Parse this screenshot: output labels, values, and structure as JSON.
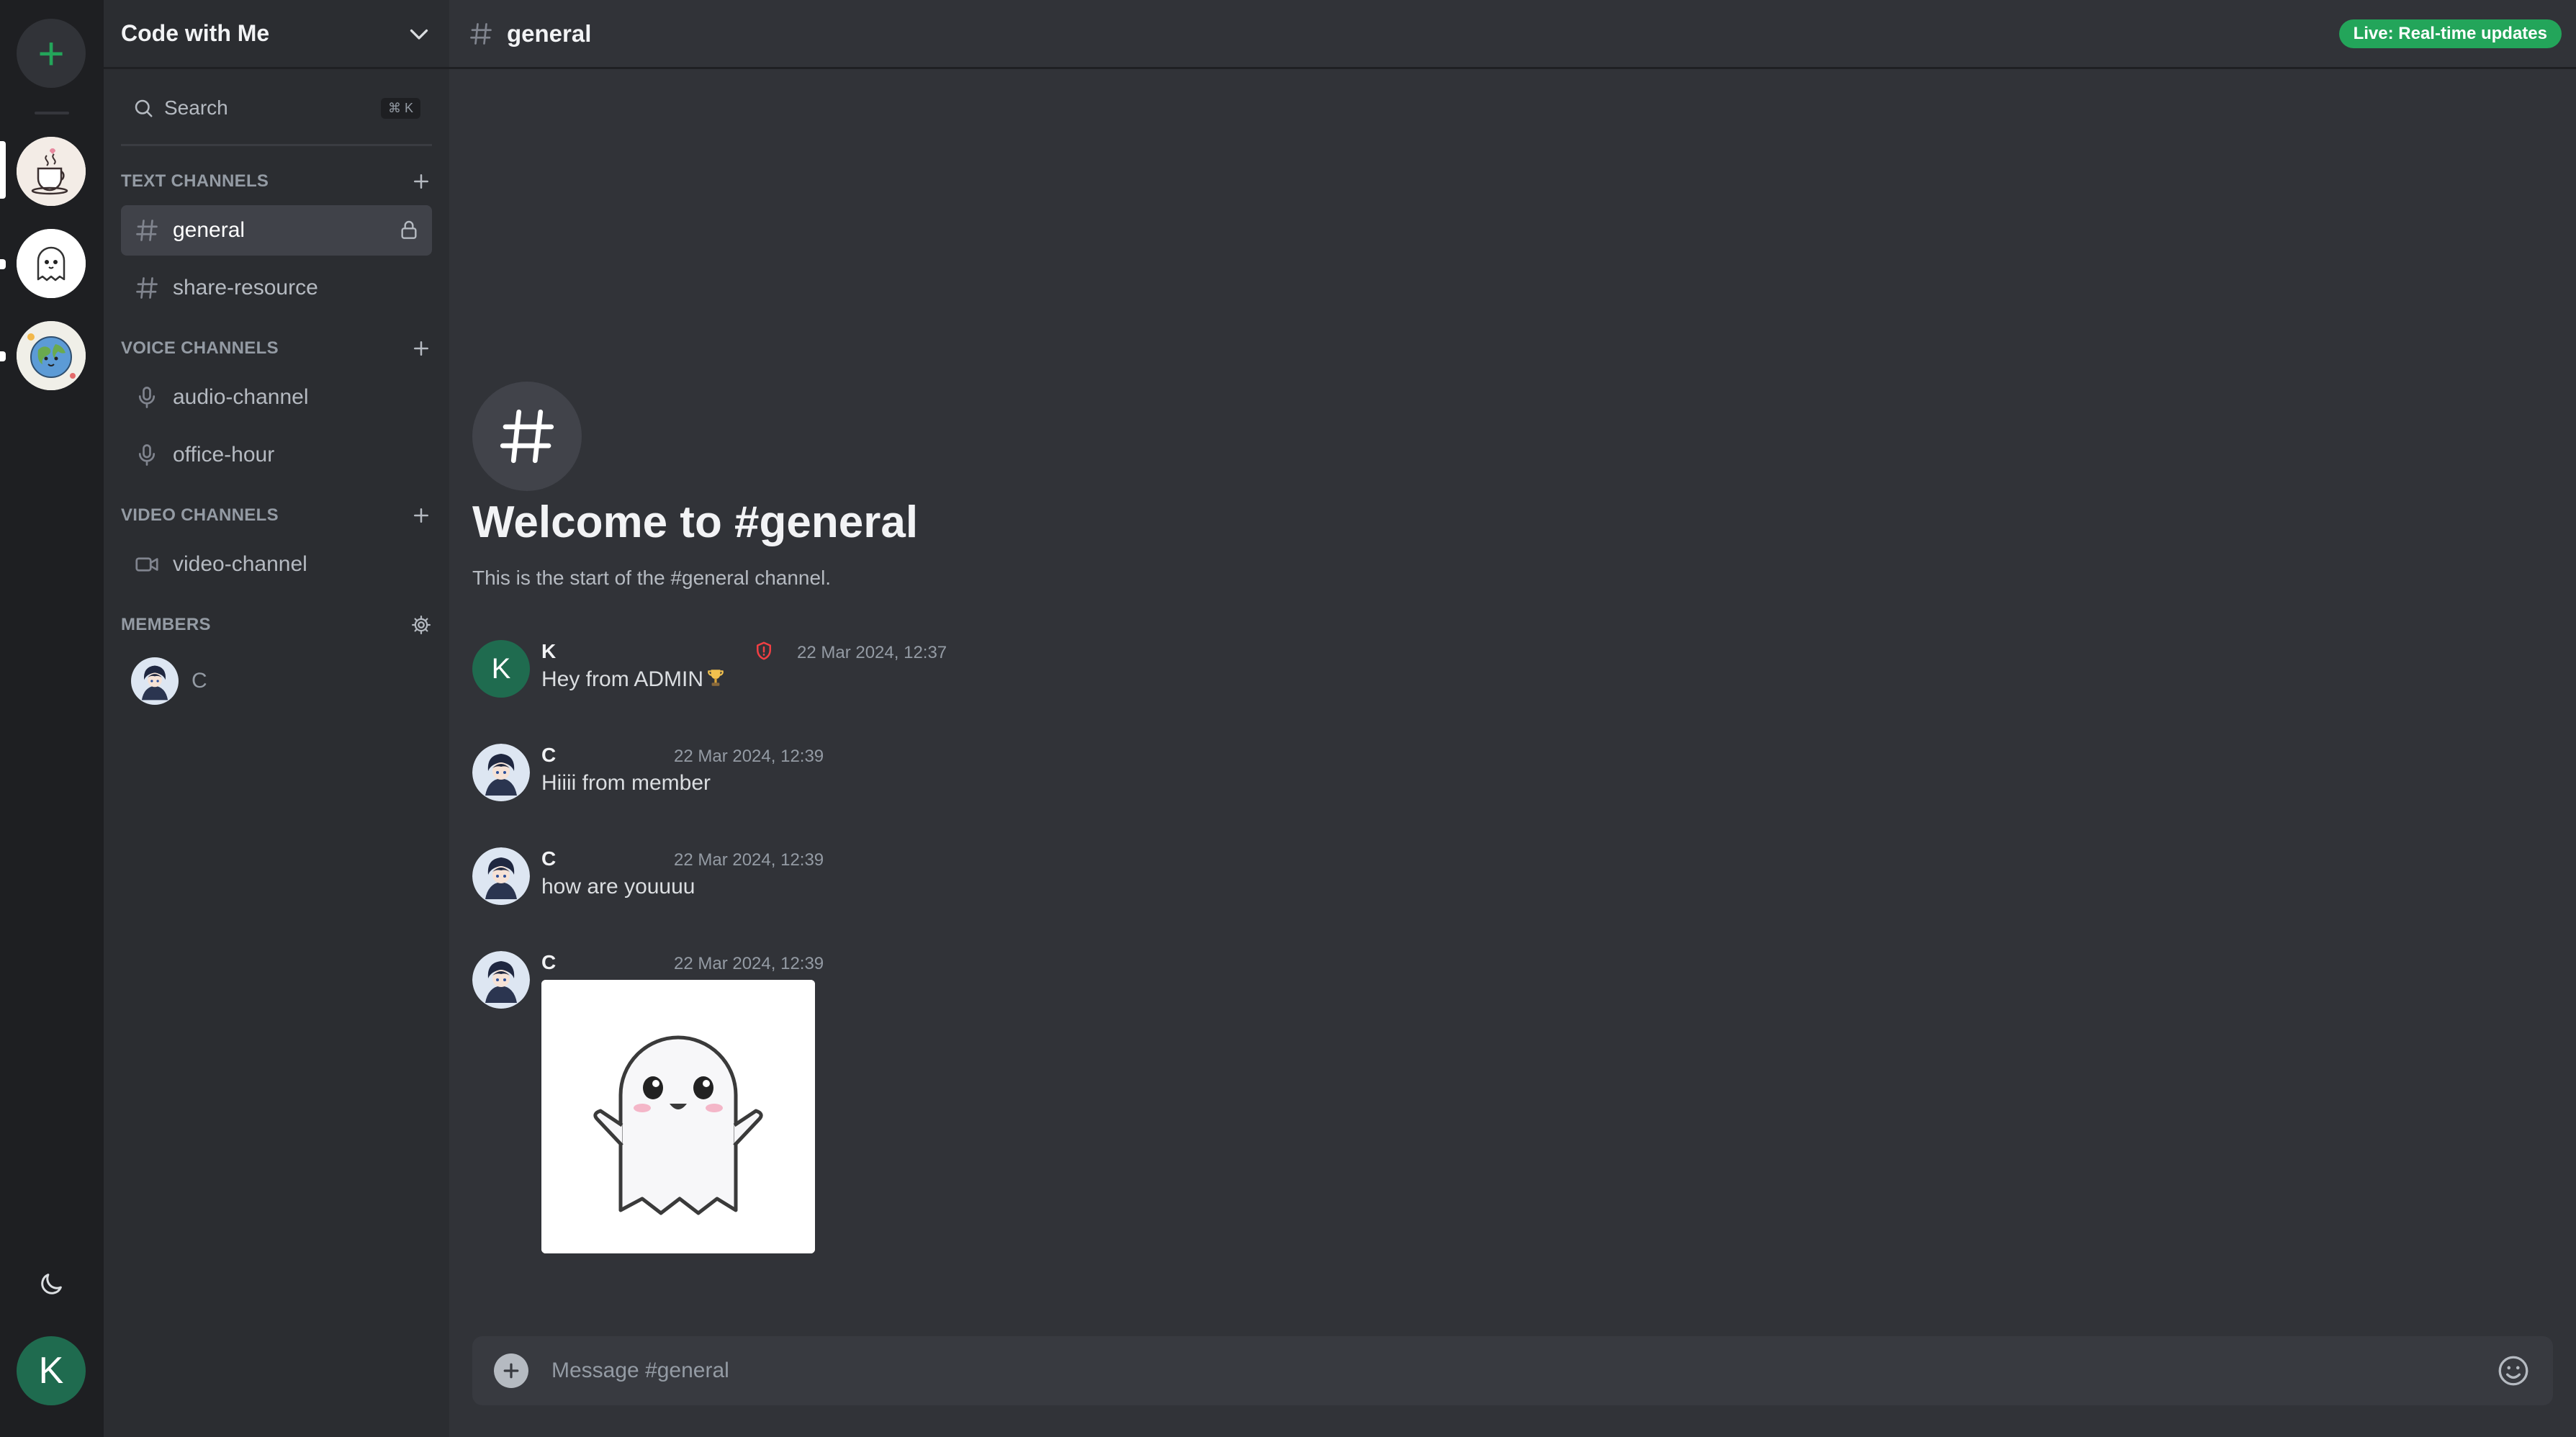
{
  "rail": {
    "add_server_glyph": "+",
    "servers": [
      {
        "name": "coffee-server",
        "icon": "coffee-cup-icon",
        "active": true
      },
      {
        "name": "ghost-server",
        "icon": "ghost-icon",
        "active": false
      },
      {
        "name": "earth-server",
        "icon": "earth-icon",
        "active": false
      }
    ],
    "user_initial": "K"
  },
  "sidebar": {
    "server_name": "Code with Me",
    "search_label": "Search",
    "search_shortcut": "⌘ K",
    "text_channels_label": "TEXT CHANNELS",
    "text_channels": [
      {
        "label": "general",
        "active": true,
        "locked": true
      },
      {
        "label": "share-resource",
        "active": false,
        "locked": false
      }
    ],
    "voice_channels_label": "VOICE CHANNELS",
    "voice_channels": [
      {
        "label": "audio-channel"
      },
      {
        "label": "office-hour"
      }
    ],
    "video_channels_label": "VIDEO CHANNELS",
    "video_channels": [
      {
        "label": "video-channel"
      }
    ],
    "members_label": "MEMBERS",
    "members": [
      {
        "name": "C"
      }
    ]
  },
  "chat": {
    "channel_name": "general",
    "live_badge": "Live: Real-time updates",
    "welcome_title": "Welcome to #general",
    "welcome_subtitle": "This is the start of the #general channel.",
    "messages": [
      {
        "author": "K",
        "role_icon": "admin-shield-icon",
        "time": "22 Mar 2024, 12:37",
        "text": "Hey from ADMIN"
      },
      {
        "author": "C",
        "time": "22 Mar 2024, 12:39",
        "text": "Hiiii from member"
      },
      {
        "author": "C",
        "time": "22 Mar 2024, 12:39",
        "text": "how are youuuu"
      },
      {
        "author": "C",
        "time": "22 Mar 2024, 12:39",
        "attachment": "ghost-image"
      }
    ],
    "composer_placeholder": "Message #general"
  },
  "colors": {
    "rail_bg": "#1e1f22",
    "sidebar_bg": "#2b2d31",
    "main_bg": "#313338",
    "accent_green": "#23a55a",
    "admin_red": "#f23f43"
  }
}
